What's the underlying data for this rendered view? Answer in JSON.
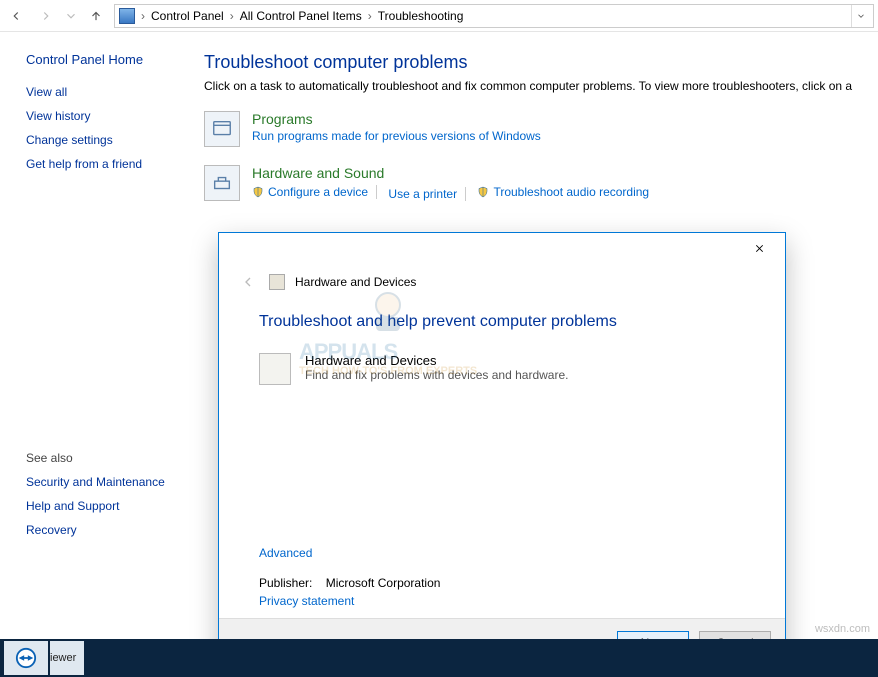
{
  "nav": {
    "crumbs": [
      "Control Panel",
      "All Control Panel Items",
      "Troubleshooting"
    ]
  },
  "left": {
    "home": "Control Panel Home",
    "links": [
      "View all",
      "View history",
      "Change settings",
      "Get help from a friend"
    ],
    "seealso_h": "See also",
    "seealso": [
      "Security and Maintenance",
      "Help and Support",
      "Recovery"
    ]
  },
  "main": {
    "title": "Troubleshoot computer problems",
    "desc": "Click on a task to automatically troubleshoot and fix common computer problems. To view more troubleshooters, click on a",
    "cat_programs": {
      "title": "Programs",
      "sub": "Run programs made for previous versions of Windows"
    },
    "cat_hw": {
      "title": "Hardware and Sound",
      "tasks": [
        "Configure a device",
        "Use a printer",
        "Troubleshoot audio recording"
      ]
    }
  },
  "dialog": {
    "head": "Hardware and Devices",
    "h1": "Troubleshoot and help prevent computer problems",
    "item_title": "Hardware and Devices",
    "item_desc": "Find and fix problems with devices and hardware.",
    "advanced": "Advanced",
    "publisher_label": "Publisher:",
    "publisher_value": "Microsoft Corporation",
    "privacy": "Privacy statement",
    "next": "Next",
    "cancel": "Cancel",
    "watermark_title": "APPUALS",
    "watermark_sub": "TECH HOW-TO'S FROM EXPERTS"
  },
  "taskbar": {
    "item_label": "iewer"
  },
  "footer_url": "wsxdn.com"
}
